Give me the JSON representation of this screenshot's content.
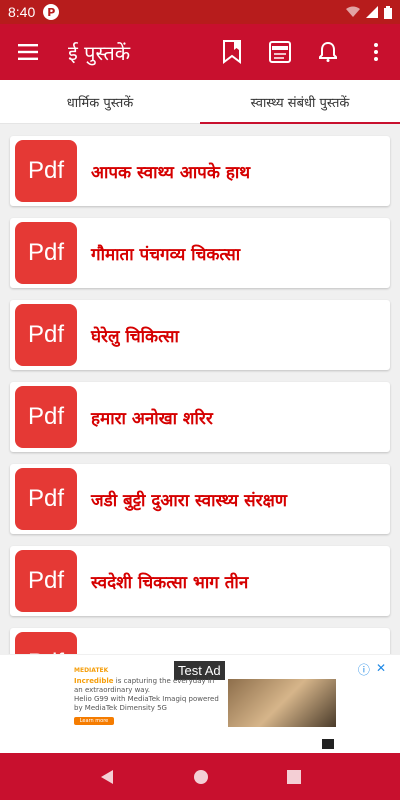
{
  "status": {
    "time": "8:40",
    "pix_letter": "P"
  },
  "app": {
    "title": "ई पुस्तकें",
    "primary_color": "#c8102e"
  },
  "tabs": [
    {
      "label": "धार्मिक पुस्तकें",
      "active": false
    },
    {
      "label": "स्वास्थ्य संबंधी पुस्तकें",
      "active": true
    }
  ],
  "books": [
    {
      "badge": "Pdf",
      "title": "आपक स्वाथ्य आपके हाथ"
    },
    {
      "badge": "Pdf",
      "title": "गौमाता पंचगव्य चिकत्सा"
    },
    {
      "badge": "Pdf",
      "title": "घेरेलु चिकित्सा"
    },
    {
      "badge": "Pdf",
      "title": "हमारा अनोखा शरिर"
    },
    {
      "badge": "Pdf",
      "title": "जडी बुट्टी दुआरा स्वास्थ्य संरक्षण"
    },
    {
      "badge": "Pdf",
      "title": "स्वदेशी चिकत्सा भाग तीन"
    },
    {
      "badge": "Pdf",
      "title": ""
    }
  ],
  "ad": {
    "tag": "Test Ad",
    "brand": "MEDIATEK",
    "headline_hl": "Incredible",
    "headline": "is capturing the everyday in an extraordinary way.",
    "line2": "Helio G99 with MediaTek Imagiq powered by MediaTek Dimensity 5G",
    "cta": "Learn more"
  }
}
